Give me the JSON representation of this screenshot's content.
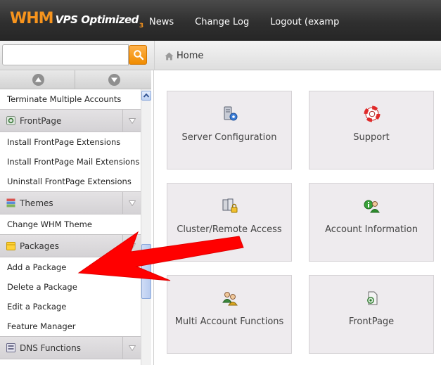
{
  "header": {
    "logo_main": "WHM",
    "logo_sub": "VPS Optimized",
    "logo_version": "3",
    "nav": [
      "News",
      "Change Log",
      "Logout (examp"
    ]
  },
  "search": {
    "placeholder": "",
    "value": ""
  },
  "breadcrumb": {
    "home": "Home"
  },
  "sidebar": {
    "items_top": [
      "Terminate Multiple Accounts"
    ],
    "frontpage": {
      "title": "FrontPage",
      "items": [
        "Install FrontPage Extensions",
        "Install FrontPage Mail Extensions",
        "Uninstall FrontPage Extensions"
      ]
    },
    "themes": {
      "title": "Themes",
      "items": [
        "Change WHM Theme"
      ]
    },
    "packages": {
      "title": "Packages",
      "items": [
        "Add a Package",
        "Delete a Package",
        "Edit a Package",
        "Feature Manager"
      ]
    },
    "dns": {
      "title": "DNS Functions"
    }
  },
  "tiles": [
    {
      "label": "Server Configuration",
      "icon": "server-config-icon"
    },
    {
      "label": "Support",
      "icon": "lifebuoy-icon"
    },
    {
      "label": "Cluster/Remote Access",
      "icon": "cluster-lock-icon"
    },
    {
      "label": "Account Information",
      "icon": "account-info-icon"
    },
    {
      "label": "Multi Account Functions",
      "icon": "multi-users-icon"
    },
    {
      "label": "FrontPage",
      "icon": "frontpage-icon"
    }
  ],
  "colors": {
    "brand_orange": "#f7941d",
    "topbar": "#2f2f2f",
    "tile_bg": "#eeebee",
    "annotation_red": "#ff0000"
  }
}
